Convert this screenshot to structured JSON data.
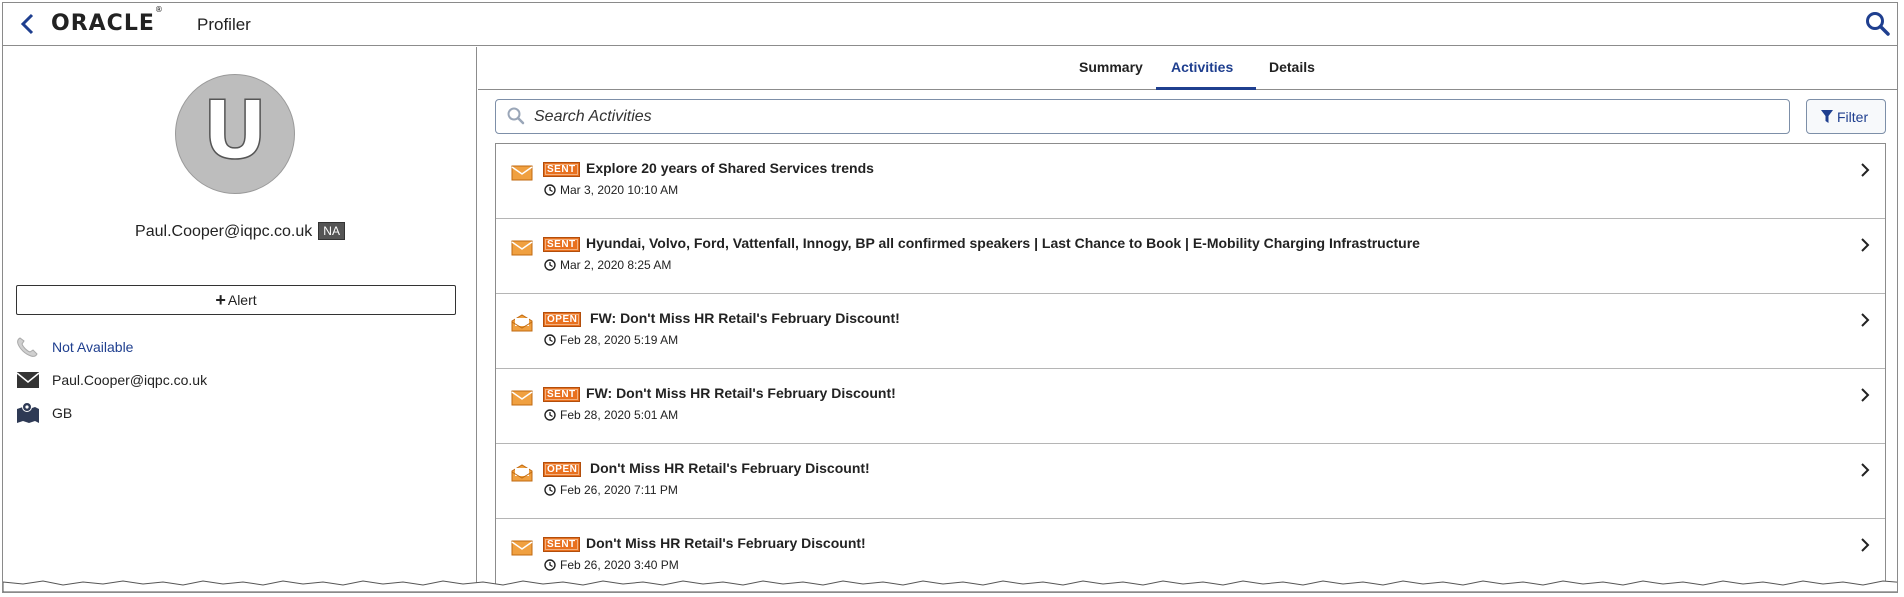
{
  "header": {
    "logo": "ORACLE",
    "app_name": "Profiler"
  },
  "profile": {
    "avatar_letter": "U",
    "email": "Paul.Cooper@iqpc.co.uk",
    "na_badge": "NA",
    "alert_label": "Alert",
    "phone": "Not Available",
    "email_line": "Paul.Cooper@iqpc.co.uk",
    "country": "GB"
  },
  "tabs": [
    {
      "label": "Summary"
    },
    {
      "label": "Activities",
      "active": true
    },
    {
      "label": "Details"
    }
  ],
  "search": {
    "placeholder": "Search Activities"
  },
  "filter_label": "Filter",
  "activities": [
    {
      "status": "SENT",
      "subject": "Explore 20 years of Shared Services trends",
      "time": "Mar 3, 2020 10:10 AM",
      "icon": "closed-envelope-icon"
    },
    {
      "status": "SENT",
      "subject": "Hyundai, Volvo, Ford, Vattenfall, Innogy, BP all confirmed speakers | Last Chance to Book | E-Mobility Charging Infrastructure",
      "time": "Mar 2, 2020 8:25 AM",
      "icon": "closed-envelope-icon"
    },
    {
      "status": "OPEN",
      "subject": "FW: Don't Miss HR Retail's February Discount!",
      "time": "Feb 28, 2020 5:19 AM",
      "icon": "open-envelope-icon"
    },
    {
      "status": "SENT",
      "subject": "FW: Don't Miss HR Retail's February Discount!",
      "time": "Feb 28, 2020 5:01 AM",
      "icon": "closed-envelope-icon"
    },
    {
      "status": "OPEN",
      "subject": "Don't Miss HR Retail's February Discount!",
      "time": "Feb 26, 2020 7:11 PM",
      "icon": "open-envelope-icon"
    },
    {
      "status": "SENT",
      "subject": "Don't Miss HR Retail's February Discount!",
      "time": "Feb 26, 2020 3:40 PM",
      "icon": "closed-envelope-icon"
    }
  ],
  "colors": {
    "accent": "#1f3f8f",
    "badge": "#e8701e",
    "envelope": "#f0a040"
  }
}
